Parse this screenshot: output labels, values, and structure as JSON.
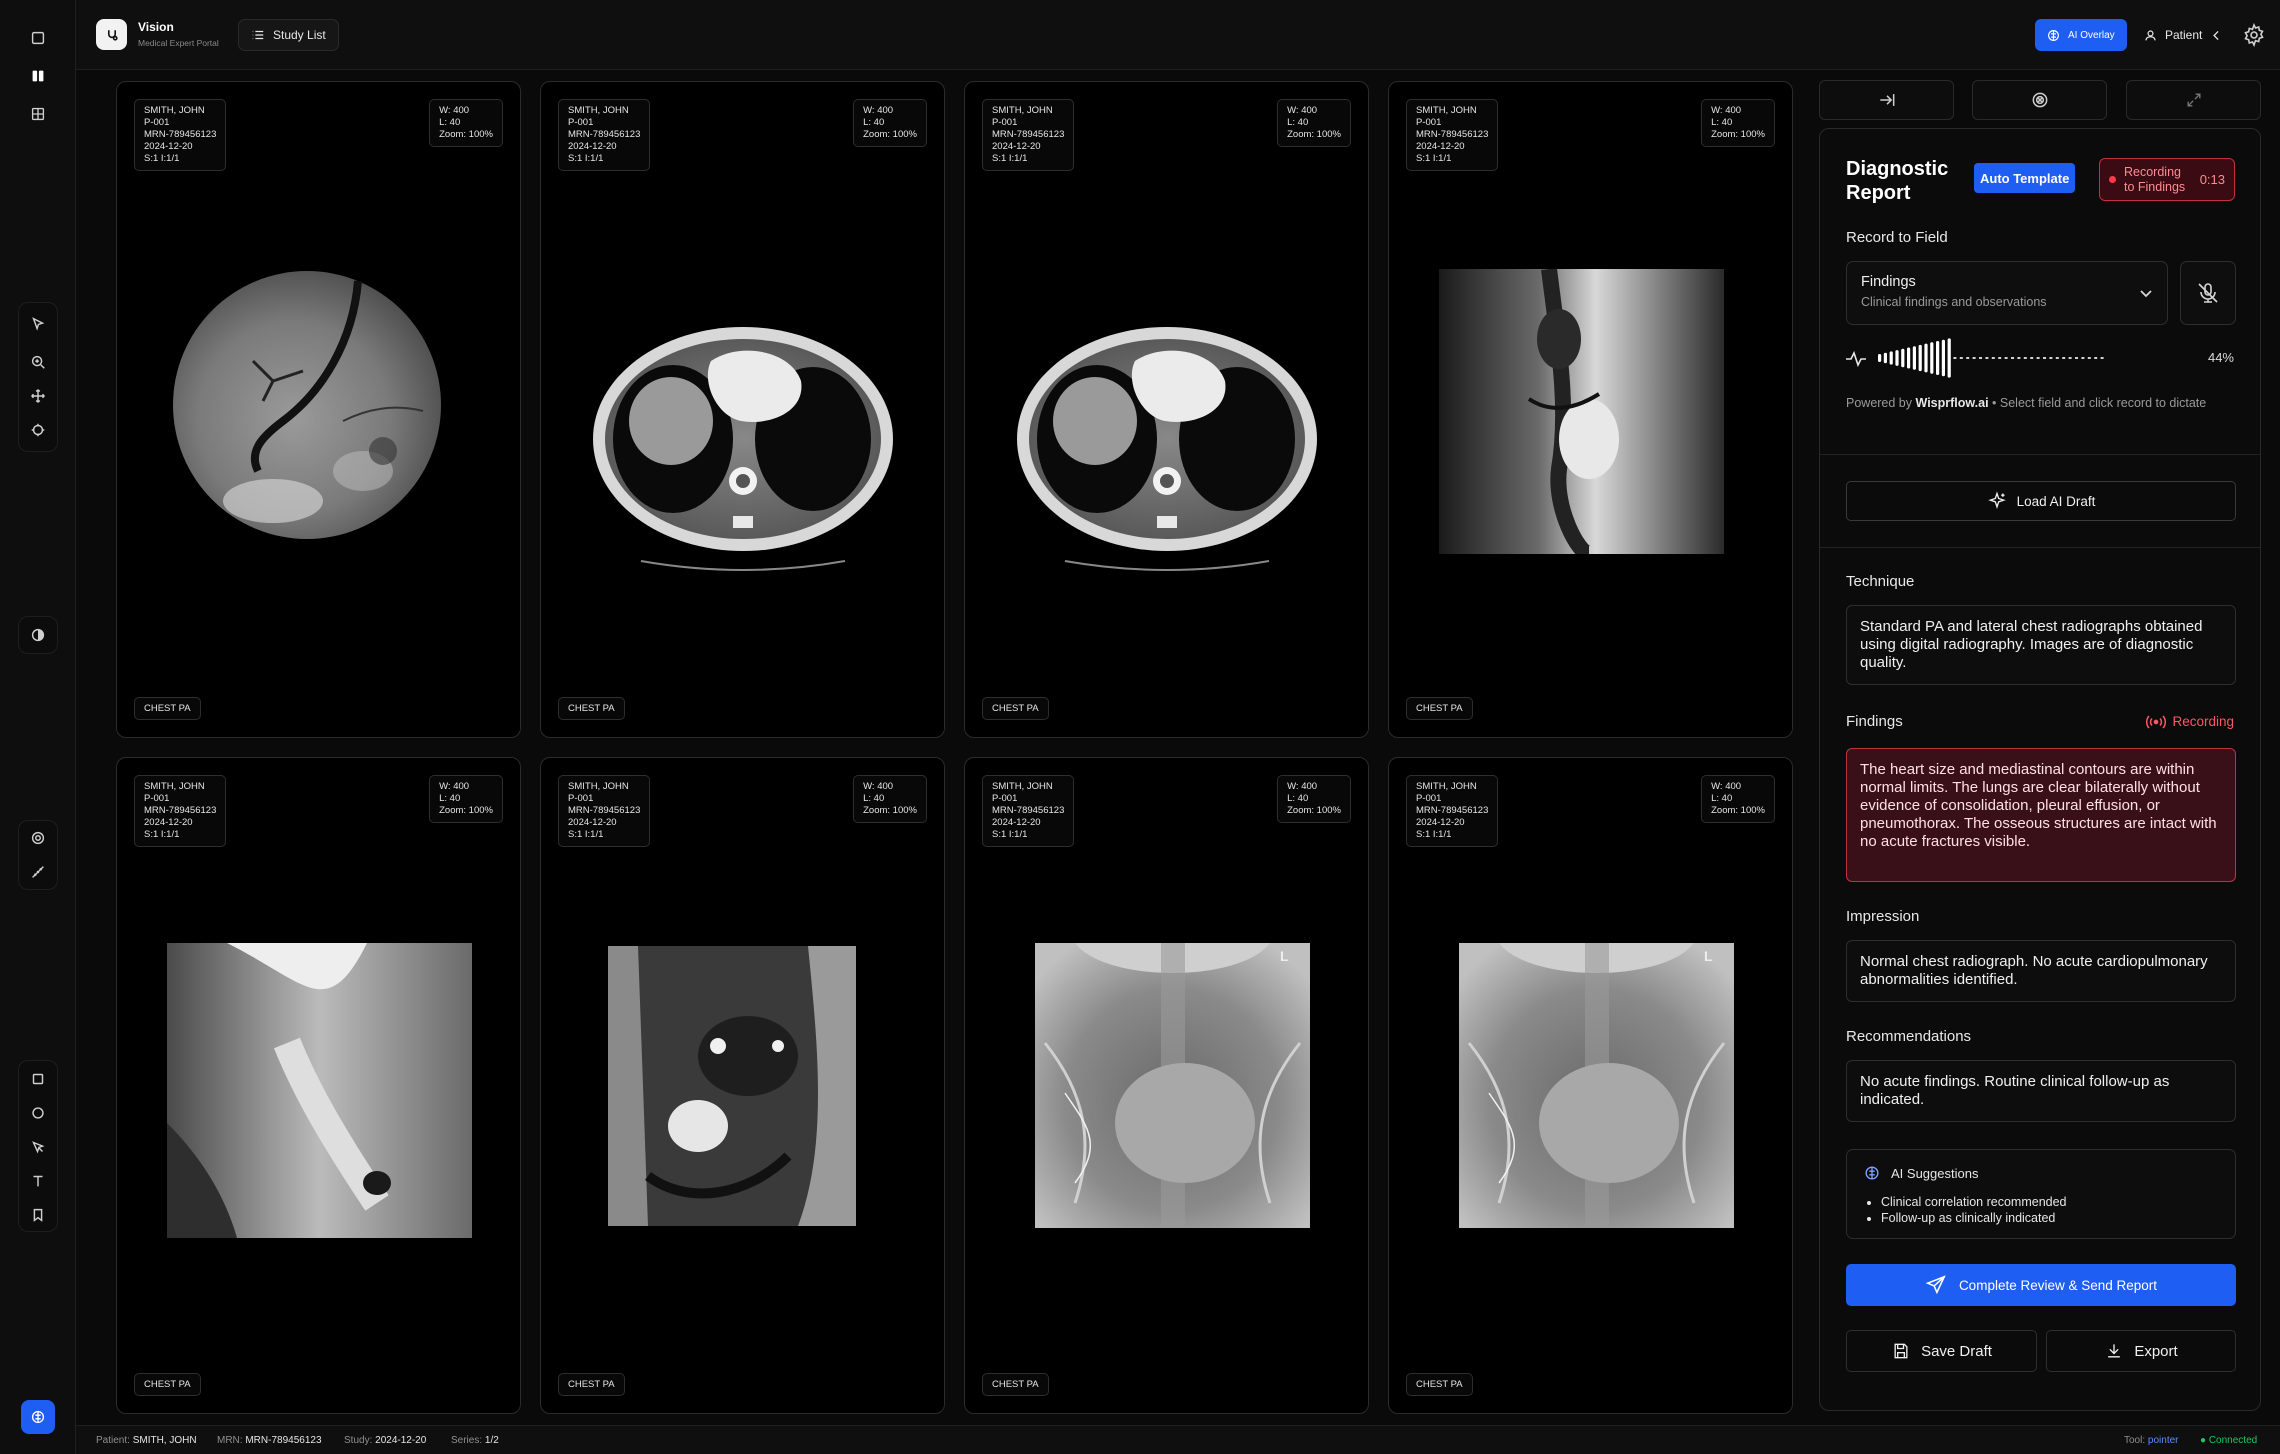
{
  "header": {
    "brand": "Vision",
    "brand_sub": "Medical Expert Portal",
    "study_list": "Study List",
    "ai_overlay": "AI Overlay",
    "patient": "Patient"
  },
  "tiles": [
    {
      "name": "SMITH, JOHN",
      "pid": "P-001",
      "mrn": "MRN-789456123",
      "date": "2024-12-20",
      "si": "S:1 I:1/1",
      "w": "W: 400",
      "l": "L: 40",
      "zoom": "Zoom: 100%",
      "series": "CHEST PA"
    },
    {
      "name": "SMITH, JOHN",
      "pid": "P-001",
      "mrn": "MRN-789456123",
      "date": "2024-12-20",
      "si": "S:1 I:1/1",
      "w": "W: 400",
      "l": "L: 40",
      "zoom": "Zoom: 100%",
      "series": "CHEST PA"
    },
    {
      "name": "SMITH, JOHN",
      "pid": "P-001",
      "mrn": "MRN-789456123",
      "date": "2024-12-20",
      "si": "S:1 I:1/1",
      "w": "W: 400",
      "l": "L: 40",
      "zoom": "Zoom: 100%",
      "series": "CHEST PA"
    },
    {
      "name": "SMITH, JOHN",
      "pid": "P-001",
      "mrn": "MRN-789456123",
      "date": "2024-12-20",
      "si": "S:1 I:1/1",
      "w": "W: 400",
      "l": "L: 40",
      "zoom": "Zoom: 100%",
      "series": "CHEST PA"
    },
    {
      "name": "SMITH, JOHN",
      "pid": "P-001",
      "mrn": "MRN-789456123",
      "date": "2024-12-20",
      "si": "S:1 I:1/1",
      "w": "W: 400",
      "l": "L: 40",
      "zoom": "Zoom: 100%",
      "series": "CHEST PA"
    },
    {
      "name": "SMITH, JOHN",
      "pid": "P-001",
      "mrn": "MRN-789456123",
      "date": "2024-12-20",
      "si": "S:1 I:1/1",
      "w": "W: 400",
      "l": "L: 40",
      "zoom": "Zoom: 100%",
      "series": "CHEST PA"
    },
    {
      "name": "SMITH, JOHN",
      "pid": "P-001",
      "mrn": "MRN-789456123",
      "date": "2024-12-20",
      "si": "S:1 I:1/1",
      "w": "W: 400",
      "l": "L: 40",
      "zoom": "Zoom: 100%",
      "series": "CHEST PA"
    },
    {
      "name": "SMITH, JOHN",
      "pid": "P-001",
      "mrn": "MRN-789456123",
      "date": "2024-12-20",
      "si": "S:1 I:1/1",
      "w": "W: 400",
      "l": "L: 40",
      "zoom": "Zoom: 100%",
      "series": "CHEST PA"
    }
  ],
  "report": {
    "title": "Diagnostic Report",
    "auto_template": "Auto Template",
    "recording_badge": "Recording to Findings",
    "recording_time": "0:13",
    "record_to_field": "Record to Field",
    "field_title": "Findings",
    "field_sub": "Clinical findings and observations",
    "level_pct": "44%",
    "level_value": 0.44,
    "powered_prefix": "Powered by",
    "powered_brand": "Wisprflow.ai",
    "powered_suffix": "• Select field and click record to dictate",
    "load_ai_draft": "Load AI Draft",
    "technique_label": "Technique",
    "technique_text": "Standard PA and lateral chest radiographs obtained using digital radiography. Images are of diagnostic quality.",
    "findings_label": "Findings",
    "findings_recording": "Recording",
    "findings_text": "The heart size and mediastinal contours are within normal limits. The lungs are clear bilaterally without evidence of consolidation, pleural effusion, or pneumothorax. The osseous structures are intact with no acute fractures visible.",
    "impression_label": "Impression",
    "impression_text": "Normal chest radiograph. No acute cardiopulmonary abnormalities identified.",
    "recommendations_label": "Recommendations",
    "recommendations_text": "No acute findings. Routine clinical follow-up as indicated.",
    "ai_suggestions_title": "AI Suggestions",
    "ai_suggestions": [
      "Clinical correlation recommended",
      "Follow-up as clinically indicated"
    ],
    "complete_btn": "Complete Review & Send Report",
    "save_draft": "Save Draft",
    "export": "Export"
  },
  "status": {
    "patient_label": "Patient:",
    "patient_value": "SMITH, JOHN",
    "mrn_label": "MRN:",
    "mrn_value": "MRN-789456123",
    "study_label": "Study:",
    "study_value": "2024-12-20",
    "series_label": "Series:",
    "series_value": "1/2",
    "tool_label": "Tool:",
    "tool_value": "pointer",
    "connected": "● Connected"
  },
  "colors": {
    "accent": "#1f5ef2",
    "recording": "#ff3b4a",
    "connected": "#22c55e"
  }
}
